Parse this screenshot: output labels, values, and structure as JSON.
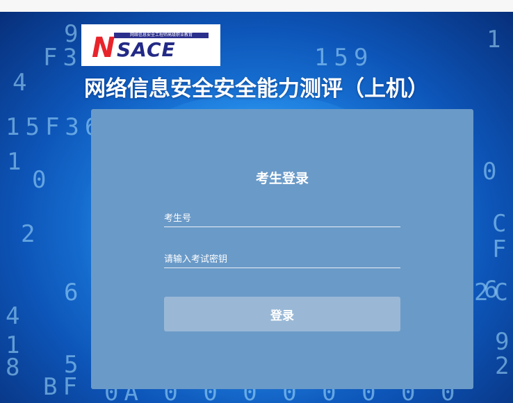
{
  "logo": {
    "letter": "N",
    "text": "SACE",
    "subtitle": "网络信息安全工程师高级职业教育"
  },
  "page": {
    "title": "网络信息安全安全能力测评（上机）"
  },
  "login": {
    "heading": "考生登录",
    "candidate_id_placeholder": "考生号",
    "exam_key_placeholder": "请输入考试密钥",
    "button_label": "登录"
  },
  "colors": {
    "panel": "#6a9ac8",
    "button": "#9ab8d6",
    "logo_red": "#e8242b",
    "logo_blue": "#232a86"
  },
  "background": {
    "glyphs": [
      "9",
      "F3",
      "4",
      "15F36",
      "1",
      "0",
      "2",
      "6",
      "4",
      "1",
      "8",
      "5",
      "BF",
      "159",
      "1",
      "0",
      "C",
      "F",
      "6",
      "2C",
      "9",
      "2",
      "0A 0 0 0 0 0 0 0 0"
    ]
  }
}
